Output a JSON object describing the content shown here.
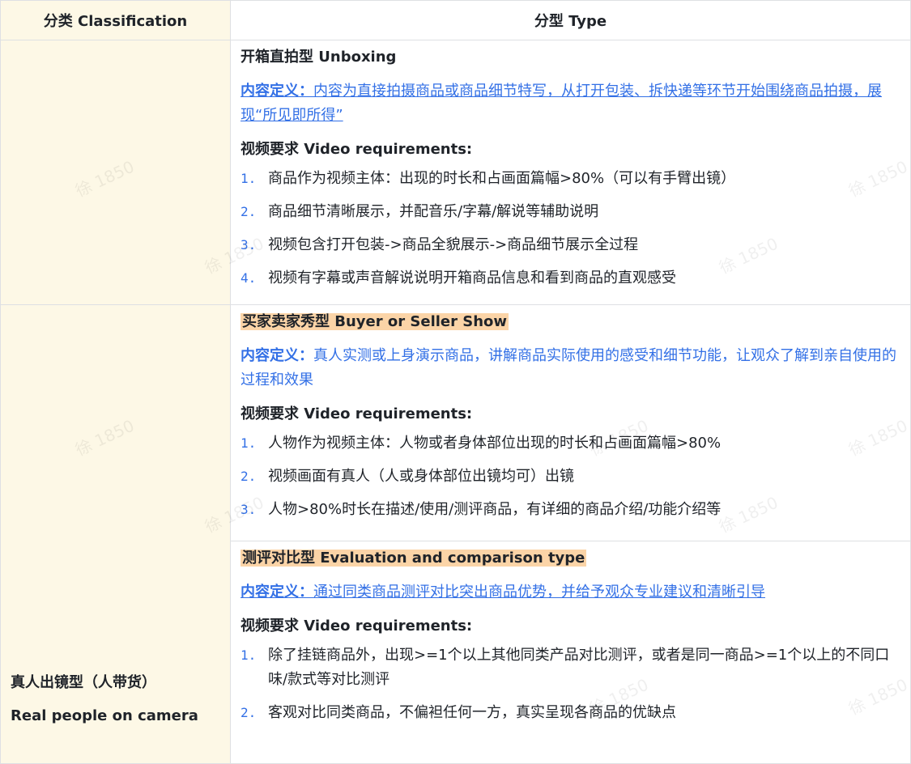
{
  "header": {
    "classification": "分类 Classification",
    "type": "分型 Type"
  },
  "sections": [
    {
      "title": "开箱直拍型 Unboxing",
      "def_label": "内容定义：",
      "def_text": "内容为直接拍摄商品或商品细节特写，从打开包装、拆快递等环节开始围绕商品拍摄，展现“所见即所得”",
      "req_label": "视频要求 Video requirements:",
      "items": [
        {
          "num": "1.",
          "text": "商品作为视频主体：出现的时长和占画面篇幅>80%（可以有手臂出镜）"
        },
        {
          "num": "2.",
          "text": "商品细节清晰展示，并配音乐/字幕/解说等辅助说明"
        },
        {
          "num": "3.",
          "text": "视频包含打开包装->商品全貌展示->商品细节展示全过程"
        },
        {
          "num": "4.",
          "text": "视频有字幕或声音解说说明开箱商品信息和看到商品的直观感受"
        }
      ]
    },
    {
      "title": "买家卖家秀型 Buyer or Seller Show",
      "def_label": "内容定义：",
      "def_text": "真人实测或上身演示商品，讲解商品实际使用的感受和细节功能，让观众了解到亲自使用的过程和效果",
      "req_label": "视频要求 Video requirements:",
      "items": [
        {
          "num": "1.",
          "text": "人物作为视频主体：人物或者身体部位出现的时长和占画面篇幅>80%"
        },
        {
          "num": "2.",
          "text": "视频画面有真人（人或身体部位出镜均可）出镜"
        },
        {
          "num": "3.",
          "text": "人物>80%时长在描述/使用/测评商品，有详细的商品介绍/功能介绍等"
        }
      ]
    },
    {
      "title": "测评对比型 Evaluation and comparison type",
      "def_label": "内容定义：",
      "def_text": "通过同类商品测评对比突出商品优势，并给予观众专业建议和清晰引导",
      "req_label": "视频要求 Video requirements:",
      "items": [
        {
          "num": "1.",
          "text": "除了挂链商品外，出现>=1个以上其他同类产品对比测评，或者是同一商品>=1个以上的不同口味/款式等对比测评"
        },
        {
          "num": "2.",
          "text": "客观对比同类商品，不偏袒任何一方，真实呈现各商品的优缺点"
        }
      ]
    }
  ],
  "category": {
    "cn": "真人出镜型（人带货）",
    "en": "Real people on camera"
  },
  "watermark": "徐 1850"
}
